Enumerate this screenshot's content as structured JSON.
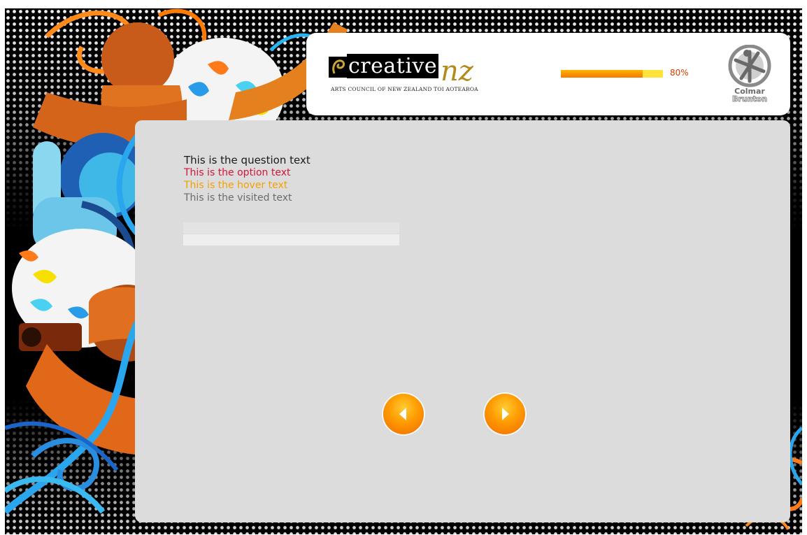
{
  "header": {
    "logo": {
      "wordmark": "creative",
      "suffix": "nz",
      "tagline": "Arts Council of New Zealand Toi Aotearoa"
    },
    "progress": {
      "value": 0.8,
      "label": "80%"
    },
    "partner_logo": {
      "line1": "Colmar",
      "line2": "Brunton"
    }
  },
  "survey": {
    "question_text": "This is the question text",
    "option_text": "This is the option text",
    "hover_text": "This is the hover text",
    "visited_text": "This is the visited text",
    "answer_input_value": ""
  },
  "navigation": {
    "prev_icon": "arrow-left-icon",
    "next_icon": "arrow-right-icon"
  },
  "colors": {
    "panel": "#dcdcdc",
    "option": "#d4153a",
    "hover": "#f3a000",
    "visited": "#6b6b6b",
    "accent": "#ff9a00"
  }
}
